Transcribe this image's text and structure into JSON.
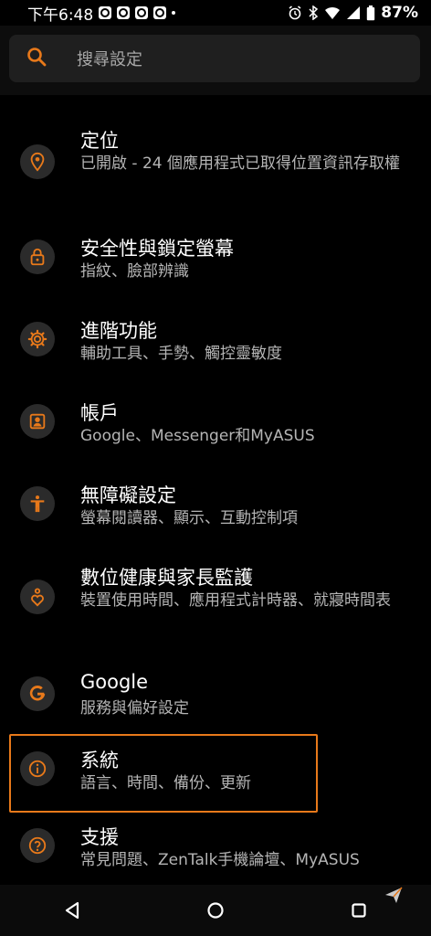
{
  "status_bar": {
    "time": "下午6:48",
    "battery": "87%",
    "icons": [
      "shopping-app-icon",
      "shopping-app-icon",
      "shopping-app-icon",
      "shopping-app-icon",
      "notification-dot",
      "alarm-icon",
      "bluetooth-icon",
      "wifi-icon",
      "signal-icon",
      "battery-icon"
    ]
  },
  "search": {
    "placeholder": "搜尋設定"
  },
  "accent_color": "#e8791a",
  "items": [
    {
      "icon": "location-icon",
      "title": "定位",
      "subtitle": "已開啟 - 24 個應用程式已取得位置資訊存取權"
    },
    {
      "icon": "lock-icon",
      "title": "安全性與鎖定螢幕",
      "subtitle": "指紋、臉部辨識"
    },
    {
      "icon": "gear-icon",
      "title": "進階功能",
      "subtitle": "輔助工具、手勢、觸控靈敏度"
    },
    {
      "icon": "account-icon",
      "title": "帳戶",
      "subtitle": "Google、Messenger和MyASUS"
    },
    {
      "icon": "accessibility-icon",
      "title": "無障礙設定",
      "subtitle": "螢幕閱讀器、顯示、互動控制項"
    },
    {
      "icon": "digital-wellbeing-icon",
      "title": "數位健康與家長監護",
      "subtitle": "裝置使用時間、應用程式計時器、就寢時間表"
    },
    {
      "icon": "google-icon",
      "title": "Google",
      "subtitle": "服務與偏好設定"
    },
    {
      "icon": "info-icon",
      "title": "系統",
      "subtitle": "語言、時間、備份、更新"
    },
    {
      "icon": "help-icon",
      "title": "支援",
      "subtitle": "常見問題、ZenTalk手機論壇、MyASUS"
    }
  ],
  "nav": [
    "back-button",
    "home-button",
    "recents-button"
  ]
}
